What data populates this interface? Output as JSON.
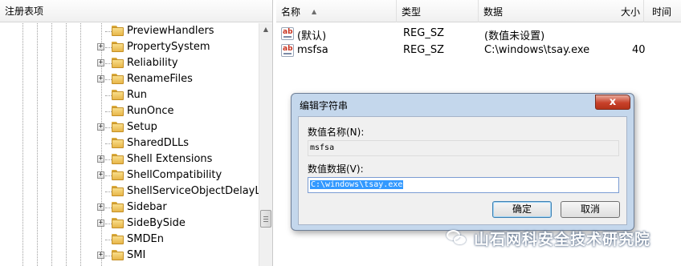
{
  "tree_header": "注册表项",
  "tree_items": [
    {
      "label": "PreviewHandlers",
      "expander": ""
    },
    {
      "label": "PropertySystem",
      "expander": "+"
    },
    {
      "label": "Reliability",
      "expander": "+"
    },
    {
      "label": "RenameFiles",
      "expander": "+"
    },
    {
      "label": "Run",
      "expander": ""
    },
    {
      "label": "RunOnce",
      "expander": ""
    },
    {
      "label": "Setup",
      "expander": "+"
    },
    {
      "label": "SharedDLLs",
      "expander": ""
    },
    {
      "label": "Shell Extensions",
      "expander": "+"
    },
    {
      "label": "ShellCompatibility",
      "expander": "+"
    },
    {
      "label": "ShellServiceObjectDelayLoad",
      "expander": ""
    },
    {
      "label": "Sidebar",
      "expander": "+"
    },
    {
      "label": "SideBySide",
      "expander": "+"
    },
    {
      "label": "SMDEn",
      "expander": ""
    },
    {
      "label": "SMI",
      "expander": "+"
    }
  ],
  "list_headers": {
    "name": "名称",
    "type": "类型",
    "data": "数据",
    "size": "大小",
    "time": "时间"
  },
  "list_rows": [
    {
      "name": "(默认)",
      "type": "REG_SZ",
      "data": "(数值未设置)",
      "size": ""
    },
    {
      "name": "msfsa",
      "type": "REG_SZ",
      "data": "C:\\windows\\tsay.exe",
      "size": "40"
    }
  ],
  "dialog": {
    "title": "编辑字符串",
    "close_label": "x",
    "name_label": "数值名称(N):",
    "name_value": "msfsa",
    "data_label": "数值数据(V):",
    "data_value": "C:\\windows\\tsay.exe",
    "ok_label": "确定",
    "cancel_label": "取消"
  },
  "watermark": "山石网科安全技术研究院",
  "icons": {
    "tree_item": "folder-icon",
    "list_value": "string-value-icon"
  }
}
